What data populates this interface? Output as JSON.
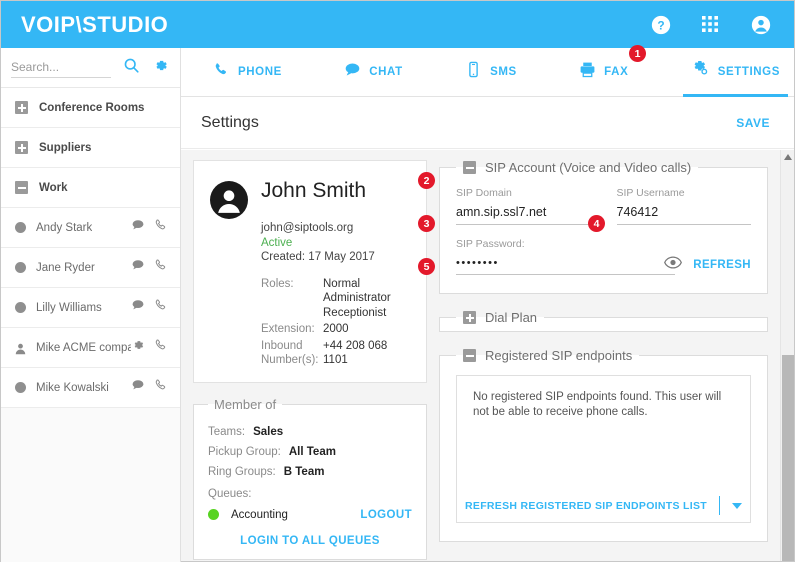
{
  "header": {
    "brand": "VOIP\\STUDIO",
    "icons": [
      {
        "name": "help-icon",
        "glyph": "?"
      },
      {
        "name": "apps-grid-icon",
        "glyph": "grid"
      },
      {
        "name": "account-icon",
        "glyph": "person"
      }
    ]
  },
  "sidebar": {
    "search": {
      "value": "",
      "placeholder": "Search..."
    },
    "tools": [
      {
        "name": "search-icon"
      },
      {
        "name": "gear-icon"
      }
    ],
    "groups": [
      {
        "label": "Conference Rooms",
        "state": "collapsed"
      },
      {
        "label": "Suppliers",
        "state": "collapsed"
      },
      {
        "label": "Work",
        "state": "expanded"
      }
    ],
    "contacts": [
      {
        "name": "Andy Stark",
        "actions": [
          "chat-icon",
          "phone-icon"
        ],
        "presence": "offline"
      },
      {
        "name": "Jane Ryder",
        "actions": [
          "chat-icon",
          "phone-icon"
        ],
        "presence": "offline"
      },
      {
        "name": "Lilly Williams",
        "actions": [
          "chat-icon",
          "phone-icon"
        ],
        "presence": "offline"
      },
      {
        "name": "Mike ACME company",
        "actions": [
          "gear-icon",
          "phone-icon"
        ],
        "presence": "contact"
      },
      {
        "name": "Mike Kowalski",
        "actions": [
          "chat-icon",
          "phone-icon"
        ],
        "presence": "offline"
      }
    ]
  },
  "tabs": [
    {
      "label": "PHONE",
      "icon": "phone-icon",
      "active": false
    },
    {
      "label": "CHAT",
      "icon": "chat-icon",
      "active": false
    },
    {
      "label": "SMS",
      "icon": "sms-icon",
      "active": false
    },
    {
      "label": "FAX",
      "icon": "fax-icon",
      "active": false
    },
    {
      "label": "SETTINGS",
      "icon": "gear-icon",
      "active": true
    }
  ],
  "page": {
    "title": "Settings",
    "save_label": "SAVE"
  },
  "profile": {
    "name": "John Smith",
    "email": "john@siptools.org",
    "status": "Active",
    "created": "Created: 17 May 2017",
    "fields": [
      {
        "key": "Roles:",
        "value": "Normal\nAdministrator\nReceptionist"
      },
      {
        "key": "Extension:",
        "value": "2000"
      },
      {
        "key": "Inbound Number(s):",
        "value": "+44 208 068 1101"
      }
    ],
    "roles": [
      "Normal",
      "Administrator",
      "Receptionist"
    ],
    "extension_label": "Extension:",
    "extension_value": "2000",
    "inbound_label": "Inbound Number(s):",
    "inbound_value": "+44 208 068 1101",
    "roles_label": "Roles:"
  },
  "member_of": {
    "legend": "Member of",
    "rows": [
      {
        "key": "Teams:",
        "value": "Sales"
      },
      {
        "key": "Pickup Group:",
        "value": "All Team"
      },
      {
        "key": "Ring Groups:",
        "value": "B Team"
      }
    ],
    "queues_label": "Queues:",
    "queue_name": "Accounting",
    "queue_logout": "LOGOUT",
    "login_all": "LOGIN TO ALL QUEUES"
  },
  "sip_account": {
    "legend": "SIP Account (Voice and Video calls)",
    "state": "expanded",
    "domain_label": "SIP Domain",
    "domain_value": "amn.sip.ssl7.net",
    "username_label": "SIP Username",
    "username_value": "746412",
    "password_label": "SIP Password:",
    "password_value": "••••••••",
    "refresh_label": "REFRESH",
    "eye_icon": "eye-icon"
  },
  "dial_plan": {
    "legend": "Dial Plan",
    "state": "collapsed"
  },
  "endpoints": {
    "legend": "Registered SIP endpoints",
    "state": "expanded",
    "message": "No registered SIP endpoints found. This user will not be able to receive phone calls.",
    "refresh_label": "REFRESH REGISTERED SIP ENDPOINTS LIST"
  },
  "badges": [
    {
      "number": "1",
      "target": "tab-settings"
    },
    {
      "number": "2",
      "target": "sip-account-legend"
    },
    {
      "number": "3",
      "target": "sip-domain-field"
    },
    {
      "number": "4",
      "target": "sip-username-field"
    },
    {
      "number": "5",
      "target": "sip-password-field"
    }
  ],
  "colors": {
    "brand_blue": "#34b7f5",
    "badge_red": "#e3192b",
    "active_green": "#4caf50",
    "queue_green": "#57d321"
  }
}
